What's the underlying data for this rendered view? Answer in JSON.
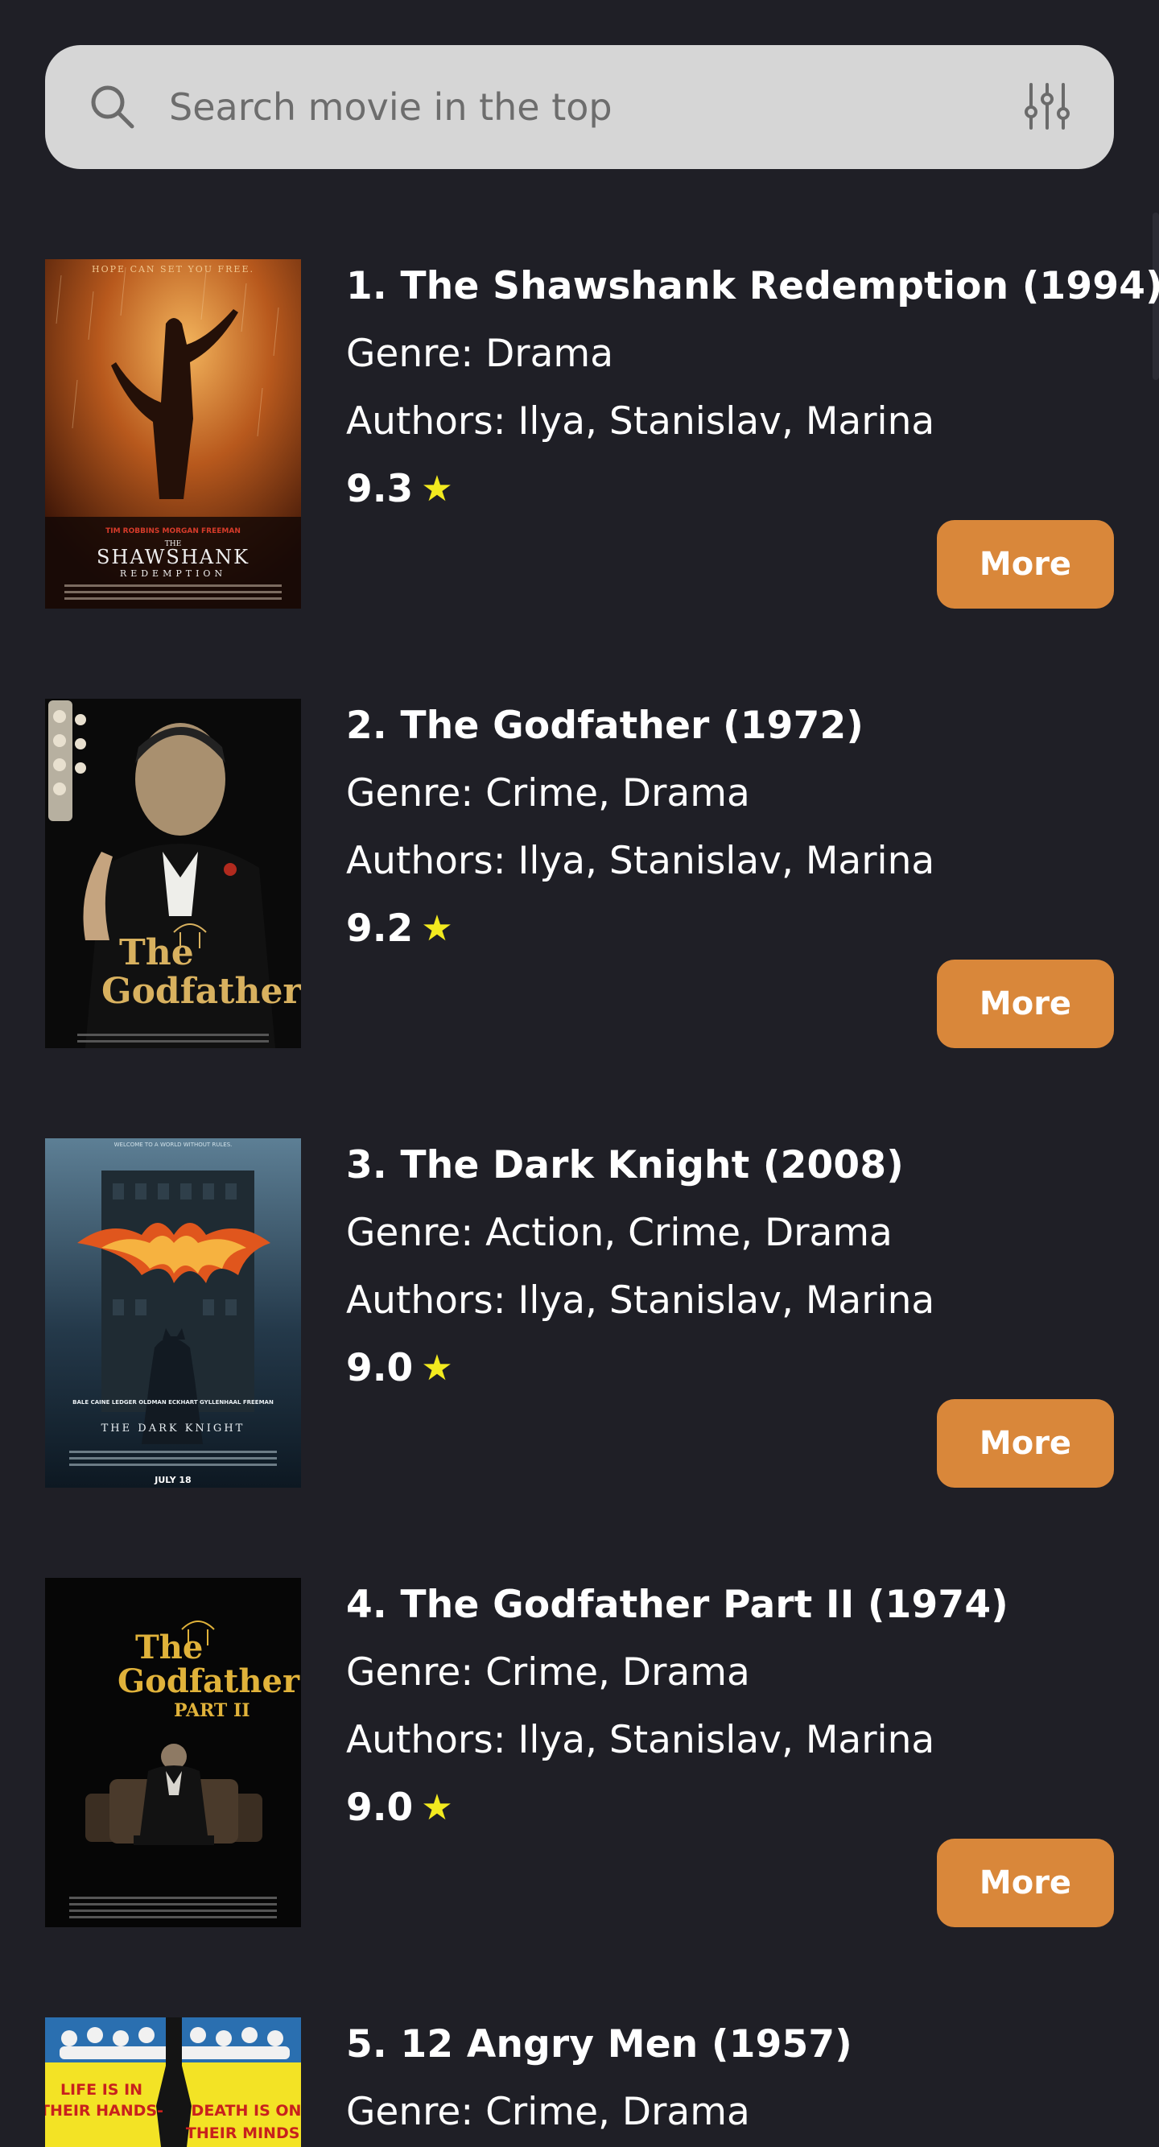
{
  "search": {
    "placeholder": "Search movie in the top"
  },
  "icons": {
    "search": "search-icon",
    "filter": "sliders-filter-icon",
    "star": "star-icon"
  },
  "colors": {
    "background": "#1f1f26",
    "search_bar": "#d6d6d6",
    "accent_button": "#d9873a",
    "star": "#f2ea1f"
  },
  "movies": [
    {
      "title": "1. The Shawshank Redemption (1994)",
      "genre": "Genre: Drama",
      "authors": "Authors: Ilya, Stanislav, Marina",
      "rating": "9.3",
      "button": "More",
      "poster": {
        "tagline": "HOPE CAN SET YOU FREE.",
        "actors": "TIM ROBBINS   MORGAN FREEMAN",
        "the": "THE",
        "title_line1": "SHAWSHANK",
        "title_line2": "REDEMPTION"
      }
    },
    {
      "title": "2. The Godfather (1972)",
      "genre": "Genre: Crime, Drama",
      "authors": "Authors: Ilya, Stanislav, Marina",
      "rating": "9.2",
      "button": "More",
      "poster": {
        "title_line1": "The",
        "title_line2": "Godfather"
      }
    },
    {
      "title": "3. The Dark Knight (2008)",
      "genre": "Genre: Action, Crime, Drama",
      "authors": "Authors: Ilya, Stanislav, Marina",
      "rating": "9.0",
      "button": "More",
      "poster": {
        "tagline": "WELCOME TO A WORLD WITHOUT RULES.",
        "actors": "BALE  CAINE  LEDGER  OLDMAN  ECKHART  GYLLENHAAL  FREEMAN",
        "title": "THE DARK KNIGHT",
        "date": "JULY 18"
      }
    },
    {
      "title": "4. The Godfather Part II (1974)",
      "genre": "Genre: Crime, Drama",
      "authors": "Authors: Ilya, Stanislav, Marina",
      "rating": "9.0",
      "button": "More",
      "poster": {
        "title_line1": "The",
        "title_line2": "Godfather",
        "title_line3": "PART II"
      }
    },
    {
      "title": "5. 12 Angry Men (1957)",
      "genre": "Genre: Crime, Drama",
      "authors": "",
      "rating": "",
      "button": "",
      "poster": {
        "left_line1": "LIFE IS IN",
        "left_line2": "THEIR HANDS-",
        "right_line1": "DEATH IS ON",
        "right_line2": "THEIR MINDS!"
      }
    }
  ]
}
